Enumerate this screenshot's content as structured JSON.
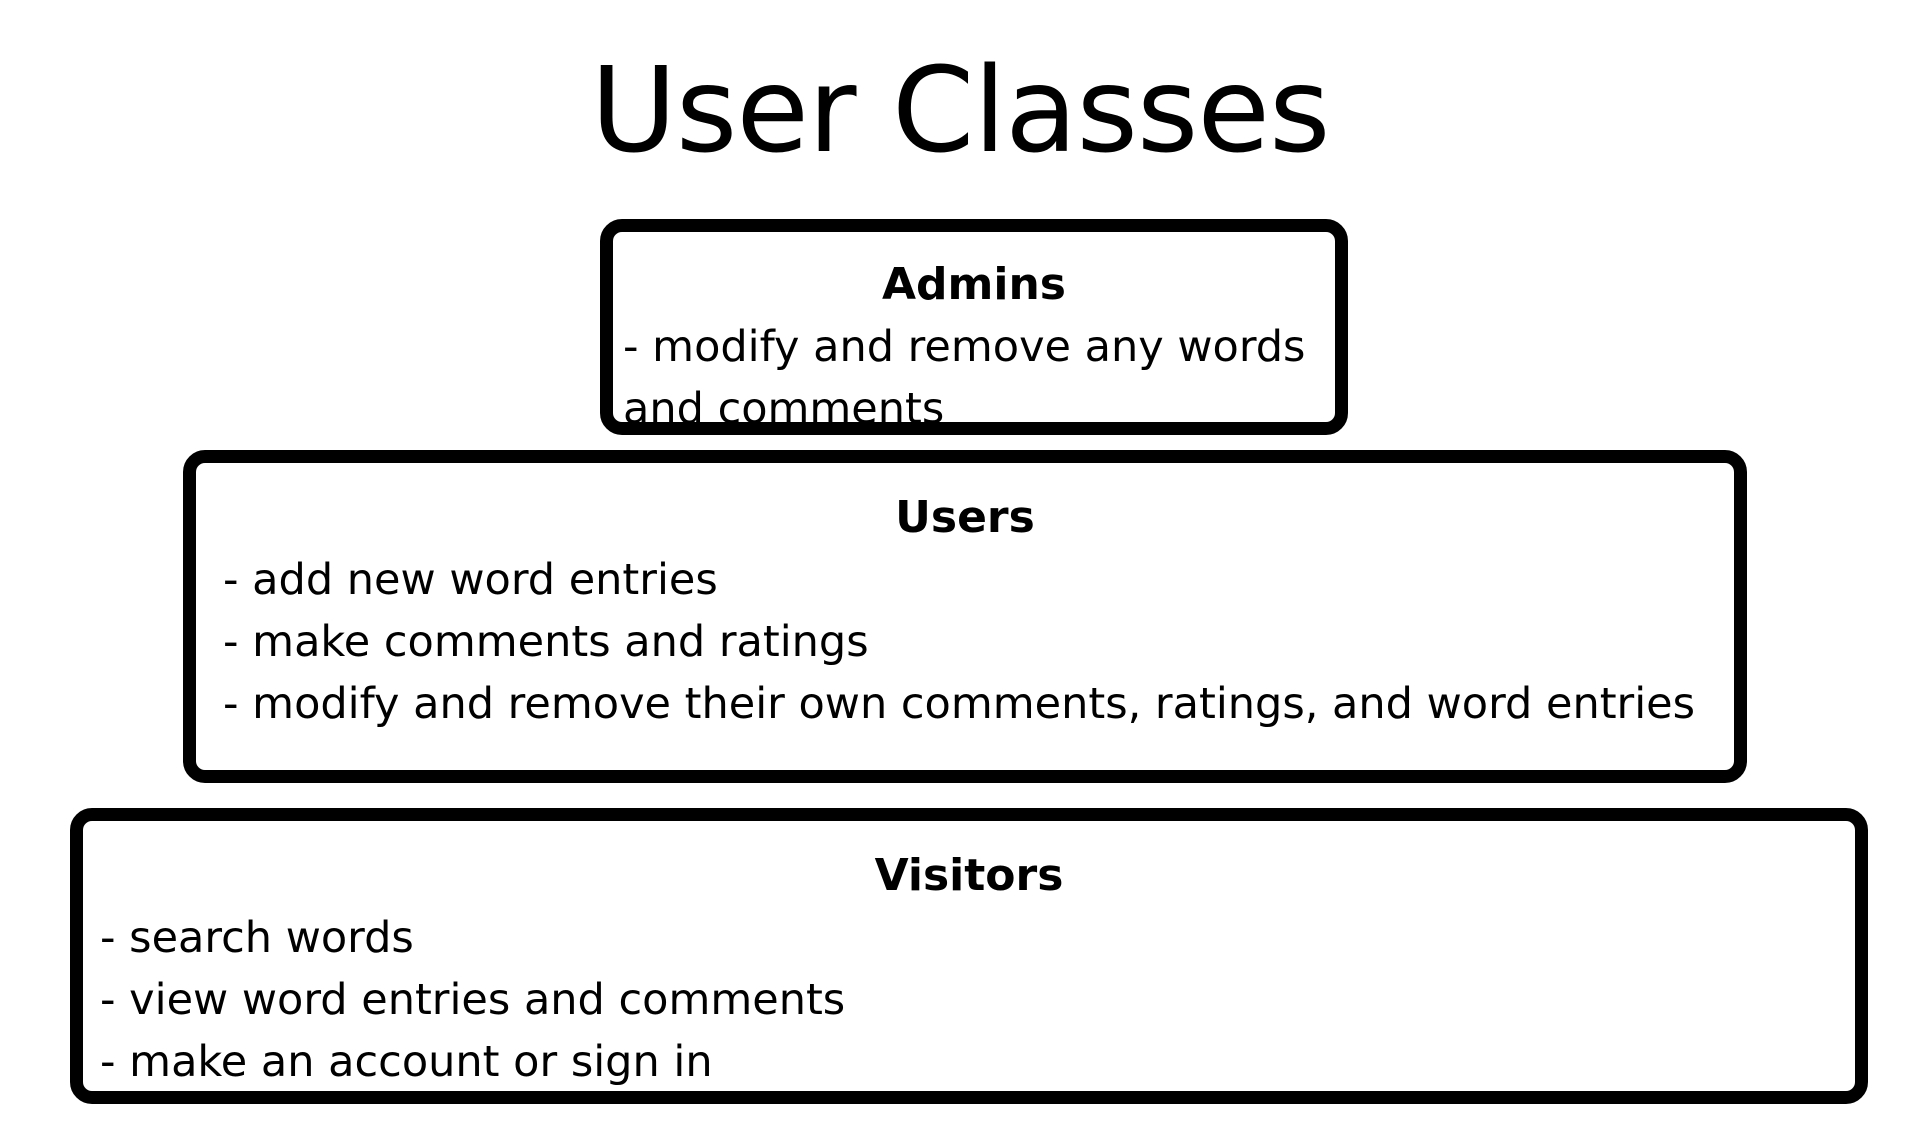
{
  "title": "User Classes",
  "classes": {
    "admins": {
      "heading": "Admins",
      "text": "- modify and remove any words and comments"
    },
    "users": {
      "heading": "Users",
      "items": [
        "- add new word entries",
        "- make comments and ratings",
        "- modify and remove their own comments, ratings, and word entries"
      ]
    },
    "visitors": {
      "heading": "Visitors",
      "items": [
        "- search words",
        "- view word entries and comments",
        "- make an account or sign in"
      ]
    }
  }
}
